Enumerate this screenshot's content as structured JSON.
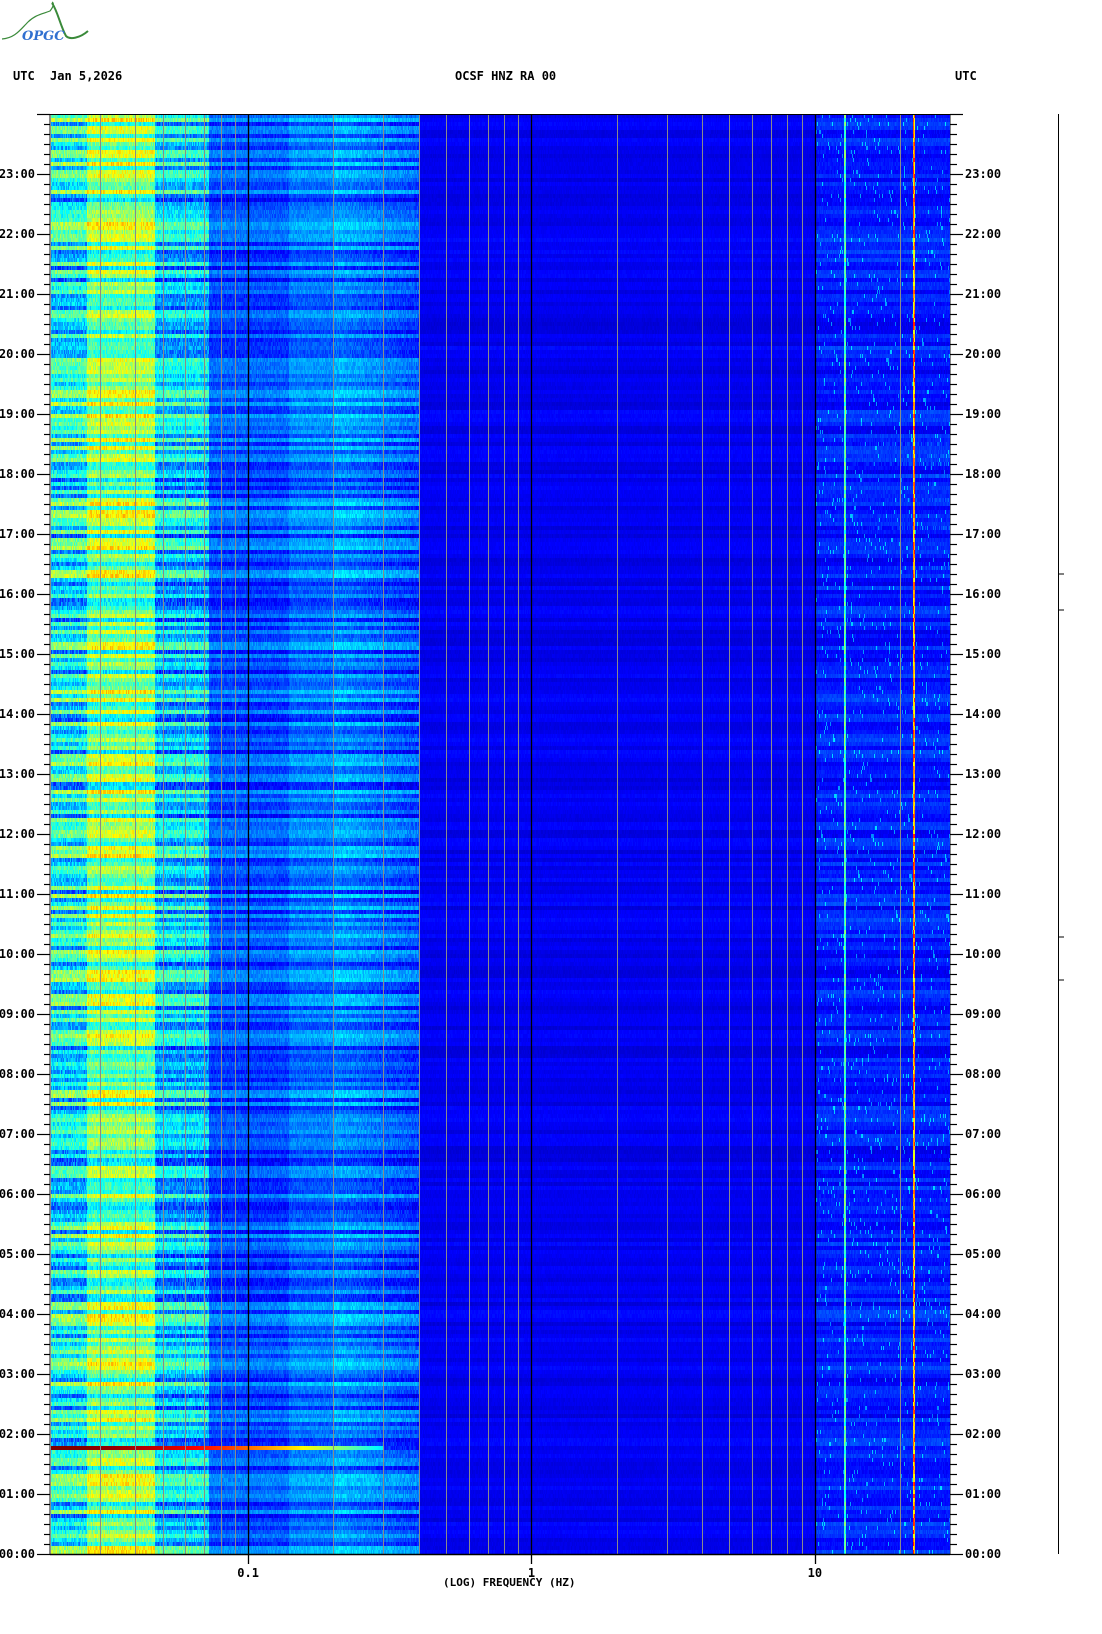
{
  "header": {
    "left_tz": "UTC",
    "date": "Jan 5,2026",
    "title": "OCSF HNZ RA 00",
    "right_tz": "UTC",
    "logo_text": "OPGC"
  },
  "chart_data": {
    "type": "heatmap",
    "title": "OCSF HNZ RA 00",
    "date": "Jan 5,2026",
    "xlabel": "(LOG) FREQUENCY (HZ)",
    "ylabel": "UTC",
    "x_scale": "log",
    "xlim": [
      0.02,
      30
    ],
    "ylim_hours": [
      0,
      24
    ],
    "colormap": "jet",
    "x_ticks": [
      {
        "value": 0.1,
        "label": "0.1"
      },
      {
        "value": 1,
        "label": "1"
      },
      {
        "value": 10,
        "label": "10"
      }
    ],
    "y_ticks": [
      "00:00",
      "01:00",
      "02:00",
      "03:00",
      "04:00",
      "05:00",
      "06:00",
      "07:00",
      "08:00",
      "09:00",
      "10:00",
      "11:00",
      "12:00",
      "13:00",
      "14:00",
      "15:00",
      "16:00",
      "17:00",
      "18:00",
      "19:00",
      "20:00",
      "21:00",
      "22:00",
      "23:00"
    ],
    "band_profile": [
      {
        "f_min": 0.02,
        "f_max": 0.027,
        "level": 0.38,
        "var": 0.22
      },
      {
        "f_min": 0.027,
        "f_max": 0.047,
        "level": 0.5,
        "var": 0.2
      },
      {
        "f_min": 0.047,
        "f_max": 0.073,
        "level": 0.33,
        "var": 0.2
      },
      {
        "f_min": 0.073,
        "f_max": 0.14,
        "level": 0.2,
        "var": 0.1
      },
      {
        "f_min": 0.14,
        "f_max": 0.2,
        "level": 0.24,
        "var": 0.1
      },
      {
        "f_min": 0.2,
        "f_max": 0.4,
        "level": 0.27,
        "var": 0.12
      },
      {
        "f_min": 0.4,
        "f_max": 10,
        "level": 0.11,
        "var": 0.03
      },
      {
        "f_min": 10,
        "f_max": 30,
        "level": 0.15,
        "var": 0.06
      }
    ],
    "events": [
      {
        "time_h": 1.75,
        "f_max": 0.3,
        "level": 1.0
      }
    ],
    "noise_periods": [
      {
        "start_h": 16.2,
        "end_h": 18.8,
        "f_min": 3,
        "level": 0.24
      }
    ],
    "spectral_lines": [
      {
        "freq": 12.8,
        "level": 0.45
      },
      {
        "freq": 22.4,
        "level": 0.72
      }
    ]
  }
}
